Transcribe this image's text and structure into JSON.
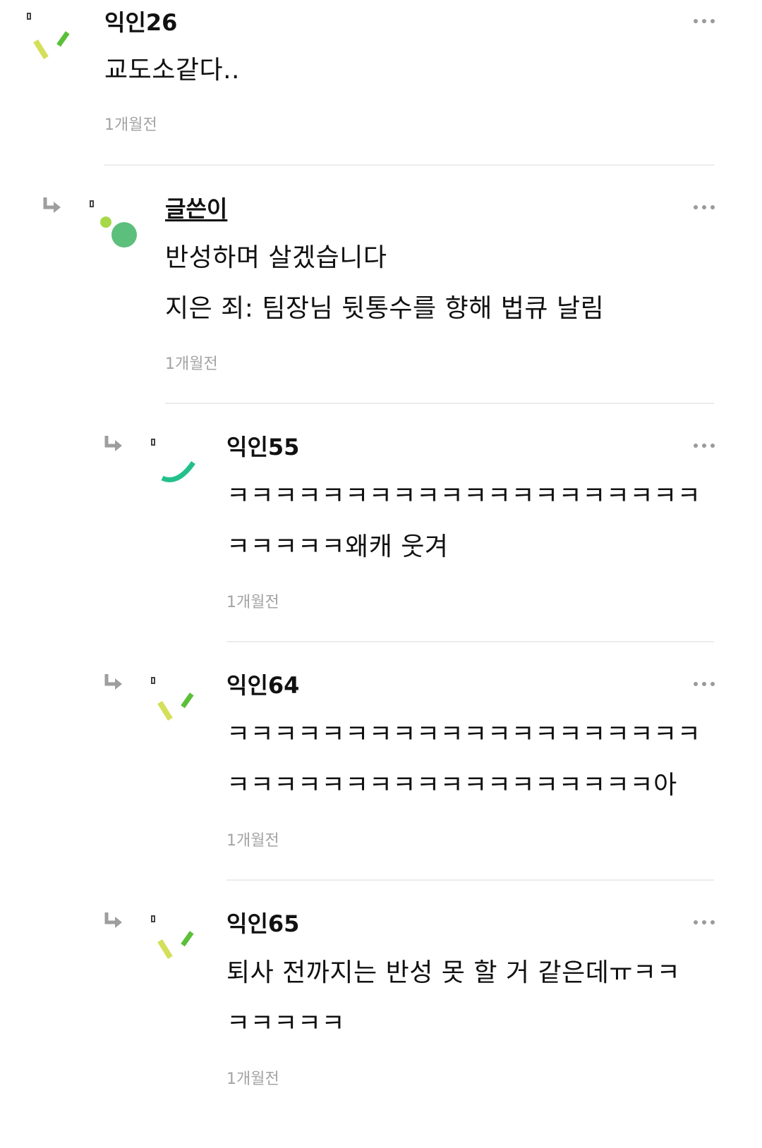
{
  "comments": [
    {
      "nickname": "익인26",
      "lines": [
        "교도소같다.."
      ],
      "time": "1개월전",
      "is_author": false
    },
    {
      "nickname": "글쓴이",
      "lines": [
        "반성하며 살겠습니다",
        "지은 죄: 팀장님 뒷통수를 향해 법큐 날림"
      ],
      "time": "1개월전",
      "is_author": true
    },
    {
      "nickname": "익인55",
      "lines": [
        "ㅋㅋㅋㅋㅋㅋㅋㅋㅋㅋㅋㅋㅋㅋㅋㅋㅋㅋㅋㅋ",
        "ㅋㅋㅋㅋㅋ왜캐 웃겨"
      ],
      "time": "1개월전",
      "is_author": false
    },
    {
      "nickname": "익인64",
      "lines": [
        "ㅋㅋㅋㅋㅋㅋㅋㅋㅋㅋㅋㅋㅋㅋㅋㅋㅋㅋㅋㅋ",
        "ㅋㅋㅋㅋㅋㅋㅋㅋㅋㅋㅋㅋㅋㅋㅋㅋㅋㅋ아"
      ],
      "time": "1개월전",
      "is_author": false
    },
    {
      "nickname": "익인65",
      "lines": [
        "퇴사 전까지는 반성 못 할 거 같은데ㅠㅋㅋ",
        "ㅋㅋㅋㅋㅋ"
      ],
      "time": "1개월전",
      "is_author": false
    }
  ],
  "icons": {
    "reply": "reply-arrow-icon",
    "more": "more-options-icon",
    "avatar_default": "random-avatar-icon"
  },
  "colors": {
    "reply_arrow": "#9e9e9e",
    "time_text": "#a3a3a3",
    "divider": "#ececec",
    "avatar_green": "#5bbf3a",
    "avatar_yellow": "#d4df5a",
    "avatar_teal": "#23c08a",
    "avatar_circle": "#5cbf7b",
    "avatar_dot": "#a6d94a"
  }
}
